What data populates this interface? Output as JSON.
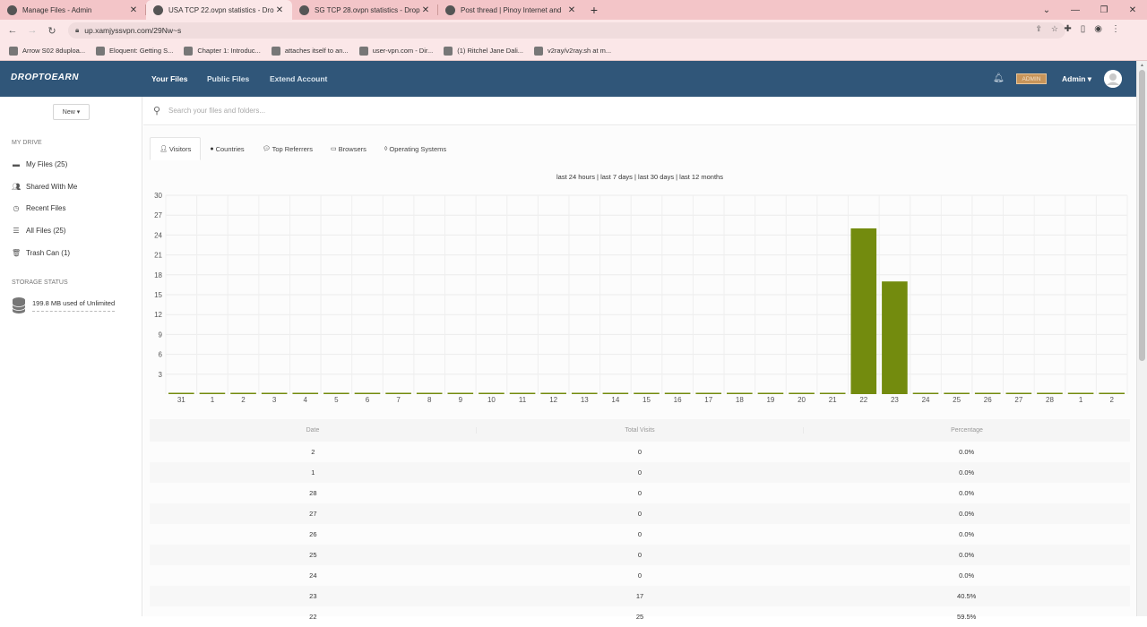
{
  "browser": {
    "tabs": [
      {
        "title": "Manage Files - Admin",
        "active": false,
        "icon": "globe-icon"
      },
      {
        "title": "USA TCP 22.ovpn statistics - Drop",
        "active": true,
        "icon": "globe-icon"
      },
      {
        "title": "SG TCP 28.ovpn statistics - Drop",
        "active": false,
        "icon": "globe-icon"
      },
      {
        "title": "Post thread | Pinoy Internet and",
        "active": false,
        "icon": "globe-icon"
      }
    ],
    "url": "up.xamjyssvpn.com/29Nw~s",
    "bookmarks": [
      "Arrow S02 8duploa...",
      "Eloquent: Getting S...",
      "Chapter 1: Introduc...",
      "attaches itself to an...",
      "user-vpn.com - Dir...",
      "(1) Ritchel Jane Dali...",
      "v2ray/v2ray.sh at m..."
    ]
  },
  "app": {
    "logo": "DROPTOEARN",
    "nav": [
      "Your Files",
      "Public Files",
      "Extend Account"
    ],
    "badge": "ADMIN",
    "user_label": "Admin ▾"
  },
  "sidebar": {
    "new_button": "New ▾",
    "my_drive_heading": "MY DRIVE",
    "items": [
      {
        "label": "My Files (25)",
        "icon": "folder-icon"
      },
      {
        "label": "Shared With Me",
        "icon": "users-icon"
      },
      {
        "label": "Recent Files",
        "icon": "clock-icon"
      },
      {
        "label": "All Files (25)",
        "icon": "stack-icon"
      },
      {
        "label": "Trash Can (1)",
        "icon": "trash-icon"
      }
    ],
    "storage_heading": "STORAGE STATUS",
    "storage_text": "199.8 MB used of Unlimited"
  },
  "search": {
    "placeholder": "Search your files and folders..."
  },
  "stats_tabs": [
    "Visitors",
    "Countries",
    "Top Referrers",
    "Browsers",
    "Operating Systems"
  ],
  "range_links": "last 24 hours | last 7 days | last 30 days | last 12 months",
  "colors": {
    "bar": "#738b0e",
    "nav": "#305679",
    "badge": "#c8955a"
  },
  "chart_data": {
    "type": "bar",
    "categories": [
      "31",
      "1",
      "2",
      "3",
      "4",
      "5",
      "6",
      "7",
      "8",
      "9",
      "10",
      "11",
      "12",
      "13",
      "14",
      "15",
      "16",
      "17",
      "18",
      "19",
      "20",
      "21",
      "22",
      "23",
      "24",
      "25",
      "26",
      "27",
      "28",
      "1",
      "2"
    ],
    "values": [
      0,
      0,
      0,
      0,
      0,
      0,
      0,
      0,
      0,
      0,
      0,
      0,
      0,
      0,
      0,
      0,
      0,
      0,
      0,
      0,
      0,
      0,
      25,
      17,
      0,
      0,
      0,
      0,
      0,
      0,
      0
    ],
    "y_ticks": [
      "30",
      "27",
      "24",
      "21",
      "18",
      "15",
      "12",
      "9",
      "6",
      "3"
    ],
    "ylim": [
      0,
      30
    ],
    "grid": true
  },
  "table": {
    "headers": [
      "Date",
      "Total Visits",
      "Percentage"
    ],
    "rows": [
      [
        "2",
        "0",
        "0.0%"
      ],
      [
        "1",
        "0",
        "0.0%"
      ],
      [
        "28",
        "0",
        "0.0%"
      ],
      [
        "27",
        "0",
        "0.0%"
      ],
      [
        "26",
        "0",
        "0.0%"
      ],
      [
        "25",
        "0",
        "0.0%"
      ],
      [
        "24",
        "0",
        "0.0%"
      ],
      [
        "23",
        "17",
        "40.5%"
      ],
      [
        "22",
        "25",
        "59.5%"
      ]
    ]
  }
}
